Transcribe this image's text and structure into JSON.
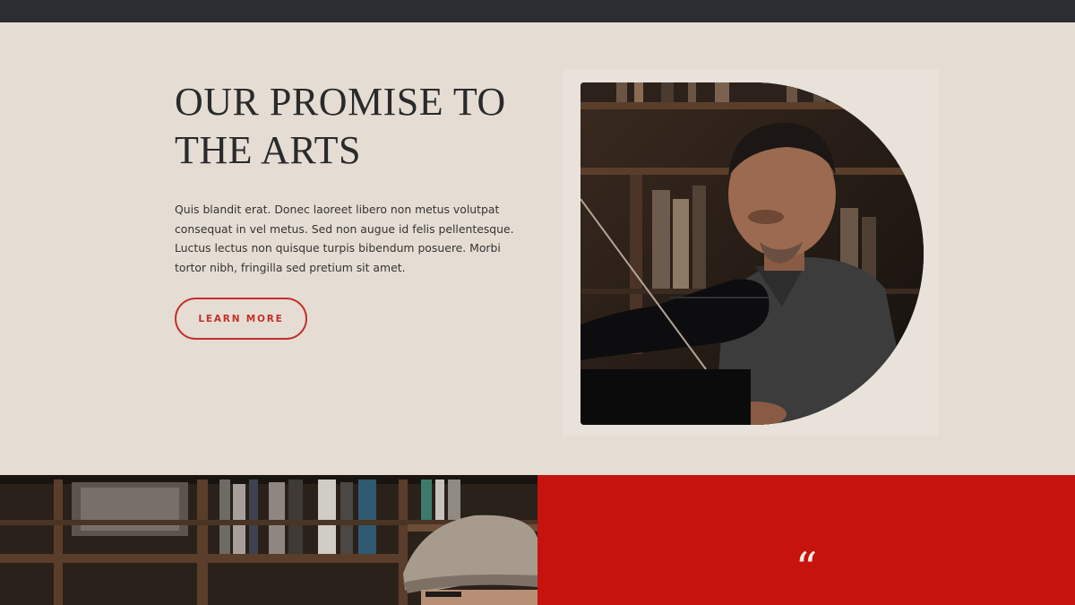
{
  "hero": {
    "heading": "OUR PROMISE TO THE ARTS",
    "body": "Quis blandit erat. Donec laoreet libero non metus volutpat consequat in vel metus. Sed non augue id felis pellentesque. Luctus lectus non quisque turpis bibendum posuere. Morbi tortor nibh, fringilla sed pretium sit amet.",
    "cta_label": "LEARN MORE"
  },
  "testimonial": {
    "quote_glyph": "“"
  },
  "colors": {
    "topbar": "#2b2d33",
    "background": "#e5ddd3",
    "accent": "#c4302a",
    "panel_red": "#c6130d"
  },
  "images": {
    "hero_photo": "violinist-in-bookstore",
    "bottom_photo": "man-in-flat-cap-with-bookshelves"
  }
}
